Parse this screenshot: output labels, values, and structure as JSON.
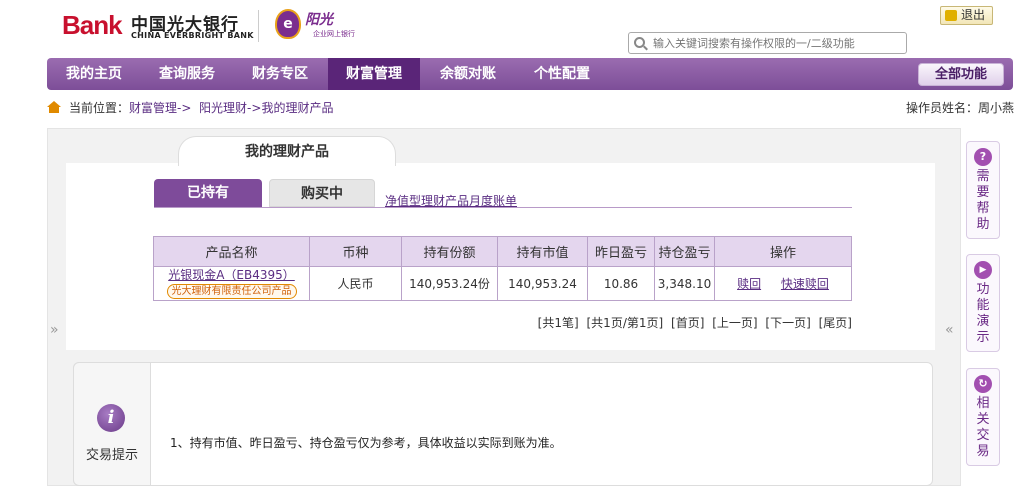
{
  "header": {
    "logo_bank_prefix": "B",
    "logo_bank_rest": "ank",
    "logo_cn": "中国光大银行",
    "logo_en": "CHINA EVERBRIGHT BANK",
    "sun_title": "阳光",
    "sun_subtitle": "企业网上银行",
    "logout_label": "退出",
    "search_placeholder": "输入关键词搜索有操作权限的一/二级功能"
  },
  "nav": {
    "items": [
      {
        "label": "我的主页"
      },
      {
        "label": "查询服务"
      },
      {
        "label": "财务专区"
      },
      {
        "label": "财富管理"
      },
      {
        "label": "余额对账"
      },
      {
        "label": "个性配置"
      }
    ],
    "active_index": 3,
    "all_functions_label": "全部功能"
  },
  "breadcrumb": {
    "prefix": "当前位置：",
    "items": [
      "财富管理->",
      "阳光理财->",
      "我的理财产品"
    ]
  },
  "operator": "操作员姓名：周小燕",
  "page_title": "我的理财产品",
  "tabs": {
    "held": "已持有",
    "buying": "购买中",
    "statement_link": "净值型理财产品月度账单"
  },
  "table": {
    "headers": [
      "产品名称",
      "币种",
      "持有份额",
      "持有市值",
      "昨日盈亏",
      "持仓盈亏",
      "操作"
    ],
    "rows": [
      {
        "product_name": "光银现金A（EB4395）",
        "product_badge": "光大理财有限责任公司产品",
        "currency": "人民币",
        "shares": "140,953.24份",
        "market_value": "140,953.24",
        "yesterday_pnl": "10.86",
        "position_pnl": "3,348.10",
        "action_redeem": "赎回",
        "action_fast_redeem": "快速赎回"
      }
    ]
  },
  "pager": {
    "total": "[共1笔]",
    "pages": "[共1页/第1页]",
    "first": "[首页]",
    "prev": "[上一页]",
    "next": "[下一页]",
    "last": "[尾页]"
  },
  "tips": {
    "label": "交易提示",
    "icon_glyph": "i",
    "text": "1、持有市值、昨日盈亏、持仓盈亏仅为参考，具体收益以实际到账为准。"
  },
  "sidebar": {
    "items": [
      {
        "label": "需要帮助",
        "icon": "question-icon",
        "glyph": "?"
      },
      {
        "label": "功能演示",
        "icon": "play-icon",
        "glyph": "▶"
      },
      {
        "label": "相关交易",
        "icon": "refresh-icon",
        "glyph": "↻"
      }
    ]
  },
  "collapse_left_glyph": "»",
  "collapse_right_glyph": "«",
  "colors": {
    "brand_purple": "#7e4b9a",
    "nav_active": "#5a2578",
    "link": "#5a2d82",
    "brand_red": "#c8102e"
  }
}
